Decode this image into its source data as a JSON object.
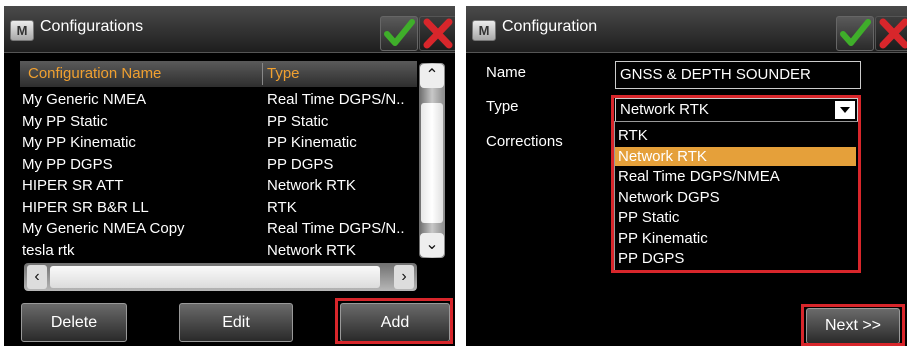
{
  "colors": {
    "accent": "#f0a030",
    "highlight": "#e5a03a",
    "check": "#3fae2a",
    "close": "#d8262b",
    "annotation": "#d8262b"
  },
  "left": {
    "title": "Configurations",
    "app_icon": "M",
    "columns": {
      "name": "Configuration Name",
      "type": "Type"
    },
    "rows": [
      {
        "name": "My Generic NMEA",
        "type": "Real Time DGPS/N.."
      },
      {
        "name": "My PP Static",
        "type": "PP Static"
      },
      {
        "name": "My PP Kinematic",
        "type": "PP Kinematic"
      },
      {
        "name": "My PP DGPS",
        "type": "PP DGPS"
      },
      {
        "name": "HIPER SR ATT",
        "type": "Network RTK"
      },
      {
        "name": "HIPER SR B&R LL",
        "type": "RTK"
      },
      {
        "name": "My Generic NMEA Copy",
        "type": "Real Time DGPS/N.."
      },
      {
        "name": "tesla rtk",
        "type": "Network RTK"
      }
    ],
    "buttons": {
      "delete": "Delete",
      "edit": "Edit",
      "add": "Add"
    },
    "icons": {
      "ok": "checkmark-icon",
      "close": "x-icon"
    }
  },
  "right": {
    "title": "Configuration",
    "app_icon": "M",
    "labels": {
      "name": "Name",
      "type": "Type",
      "corrections": "Corrections"
    },
    "name_value": "GNSS & DEPTH SOUNDER",
    "type_value": "Network RTK",
    "options": [
      "RTK",
      "Network RTK",
      "Real Time DGPS/NMEA",
      "Network DGPS",
      "PP Static",
      "PP Kinematic",
      "PP DGPS"
    ],
    "selected_option": "Network RTK",
    "next": "Next >>"
  }
}
